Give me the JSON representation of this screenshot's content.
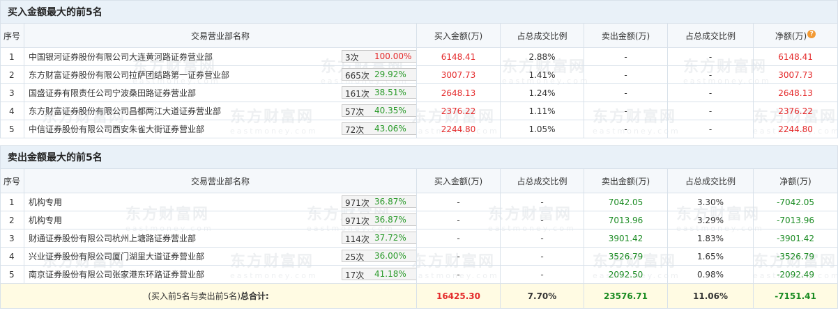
{
  "watermark": {
    "cn": "东方财富网",
    "en": "eastmoney.com"
  },
  "buy_section": {
    "title": "买入金额最大的前5名",
    "headers": [
      "序号",
      "交易营业部名称",
      "买入金额(万)",
      "占总成交比例",
      "卖出金额(万)",
      "占总成交比例",
      "净额(万)"
    ],
    "rows": [
      {
        "idx": "1",
        "name": "中国银河证券股份有限公司大连黄河路证券营业部",
        "count": "3次",
        "pct": "100.00%",
        "buy": "6148.41",
        "buy_ratio": "2.88%",
        "sell": "-",
        "sell_ratio": "-",
        "net": "6148.41"
      },
      {
        "idx": "2",
        "name": "东方财富证券股份有限公司拉萨团结路第一证券营业部",
        "count": "665次",
        "pct": "29.92%",
        "buy": "3007.73",
        "buy_ratio": "1.41%",
        "sell": "-",
        "sell_ratio": "-",
        "net": "3007.73"
      },
      {
        "idx": "3",
        "name": "国盛证券有限责任公司宁波桑田路证券营业部",
        "count": "161次",
        "pct": "38.51%",
        "buy": "2648.13",
        "buy_ratio": "1.24%",
        "sell": "-",
        "sell_ratio": "-",
        "net": "2648.13"
      },
      {
        "idx": "4",
        "name": "东方财富证券股份有限公司昌都两江大道证券营业部",
        "count": "57次",
        "pct": "40.35%",
        "buy": "2376.22",
        "buy_ratio": "1.11%",
        "sell": "-",
        "sell_ratio": "-",
        "net": "2376.22"
      },
      {
        "idx": "5",
        "name": "中信证券股份有限公司西安朱雀大街证券营业部",
        "count": "72次",
        "pct": "43.06%",
        "buy": "2244.80",
        "buy_ratio": "1.05%",
        "sell": "-",
        "sell_ratio": "-",
        "net": "2244.80"
      }
    ]
  },
  "sell_section": {
    "title": "卖出金额最大的前5名",
    "headers": [
      "序号",
      "交易营业部名称",
      "买入金额(万)",
      "占总成交比例",
      "卖出金额(万)",
      "占总成交比例",
      "净额(万)"
    ],
    "rows": [
      {
        "idx": "1",
        "name": "机构专用",
        "count": "971次",
        "pct": "36.87%",
        "buy": "-",
        "buy_ratio": "-",
        "sell": "7042.05",
        "sell_ratio": "3.30%",
        "net": "-7042.05"
      },
      {
        "idx": "2",
        "name": "机构专用",
        "count": "971次",
        "pct": "36.87%",
        "buy": "-",
        "buy_ratio": "-",
        "sell": "7013.96",
        "sell_ratio": "3.29%",
        "net": "-7013.96"
      },
      {
        "idx": "3",
        "name": "财通证券股份有限公司杭州上塘路证券营业部",
        "count": "114次",
        "pct": "37.72%",
        "buy": "-",
        "buy_ratio": "-",
        "sell": "3901.42",
        "sell_ratio": "1.83%",
        "net": "-3901.42"
      },
      {
        "idx": "4",
        "name": "兴业证券股份有限公司厦门湖里大道证券营业部",
        "count": "25次",
        "pct": "36.00%",
        "buy": "-",
        "buy_ratio": "-",
        "sell": "3526.79",
        "sell_ratio": "1.65%",
        "net": "-3526.79"
      },
      {
        "idx": "5",
        "name": "南京证券股份有限公司张家港东环路证券营业部",
        "count": "17次",
        "pct": "41.18%",
        "buy": "-",
        "buy_ratio": "-",
        "sell": "2092.50",
        "sell_ratio": "0.98%",
        "net": "-2092.49"
      }
    ]
  },
  "total": {
    "label_prefix": "(买入前5名与卖出前5名)",
    "label_strong": "总合计:",
    "buy": "16425.30",
    "buy_ratio": "7.70%",
    "sell": "23576.71",
    "sell_ratio": "11.06%",
    "net": "-7151.41"
  },
  "icons": {
    "help": "question-icon",
    "expand": "triangle-right-icon"
  },
  "colors": {
    "buy": "#e4292a",
    "sell": "#1a8b22",
    "header_bg": "#e9f1f8",
    "total_bg": "#fffbe3",
    "help_icon": "#f29a35",
    "arrow": "#2d5fa7"
  }
}
